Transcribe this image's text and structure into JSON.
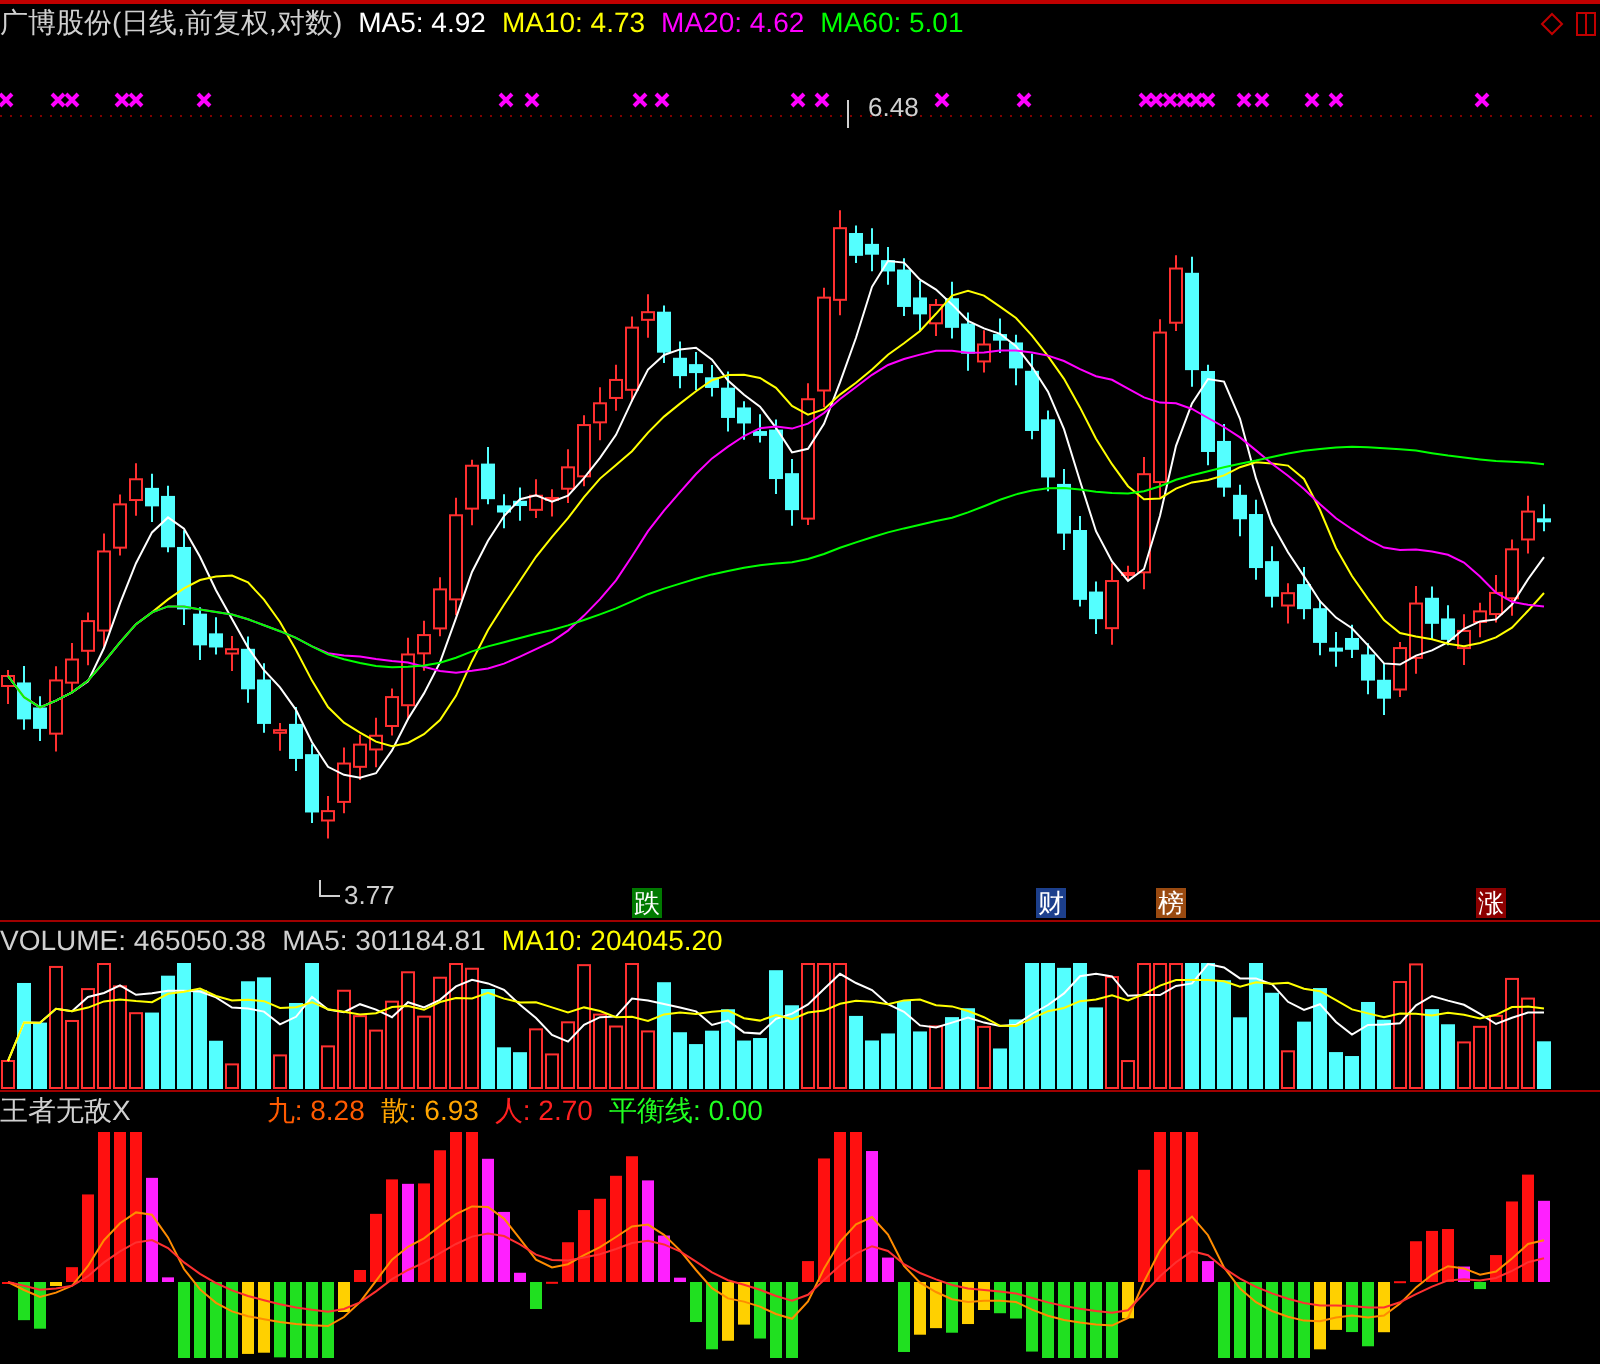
{
  "main": {
    "title": "广博股份(日线,前复权,对数)",
    "ma": [
      {
        "label": "MA5:",
        "value": "4.92",
        "color": "#ffffff"
      },
      {
        "label": "MA10:",
        "value": "4.73",
        "color": "#ffff00"
      },
      {
        "label": "MA20:",
        "value": "4.62",
        "color": "#ff00ff"
      },
      {
        "label": "MA60:",
        "value": "5.01",
        "color": "#00ff00"
      }
    ],
    "high_label": "6.48",
    "low_label": "3.77",
    "signals": [
      {
        "label": "跌",
        "color": "#007a00"
      },
      {
        "label": "财",
        "color": "#1c3f8c"
      },
      {
        "label": "榜",
        "color": "#9a4a10"
      },
      {
        "label": "涨",
        "color": "#8c0000"
      }
    ]
  },
  "volume": {
    "items": [
      {
        "label": "VOLUME:",
        "value": "465050.38",
        "color": "#d0d0d0"
      },
      {
        "label": "MA5:",
        "value": "301184.81",
        "color": "#d0d0d0"
      },
      {
        "label": "MA10:",
        "value": "204045.20",
        "color": "#ffff00"
      }
    ]
  },
  "indicator": {
    "title": "王者无敌X",
    "items": [
      {
        "label": "九:",
        "value": "8.28",
        "color": "#ff5a00"
      },
      {
        "label": "散:",
        "value": "6.93",
        "color": "#ffa500"
      },
      {
        "label": "人:",
        "value": "2.70",
        "color": "#ff2020"
      },
      {
        "label": "平衡线:",
        "value": "0.00",
        "color": "#20ff20"
      }
    ]
  }
}
